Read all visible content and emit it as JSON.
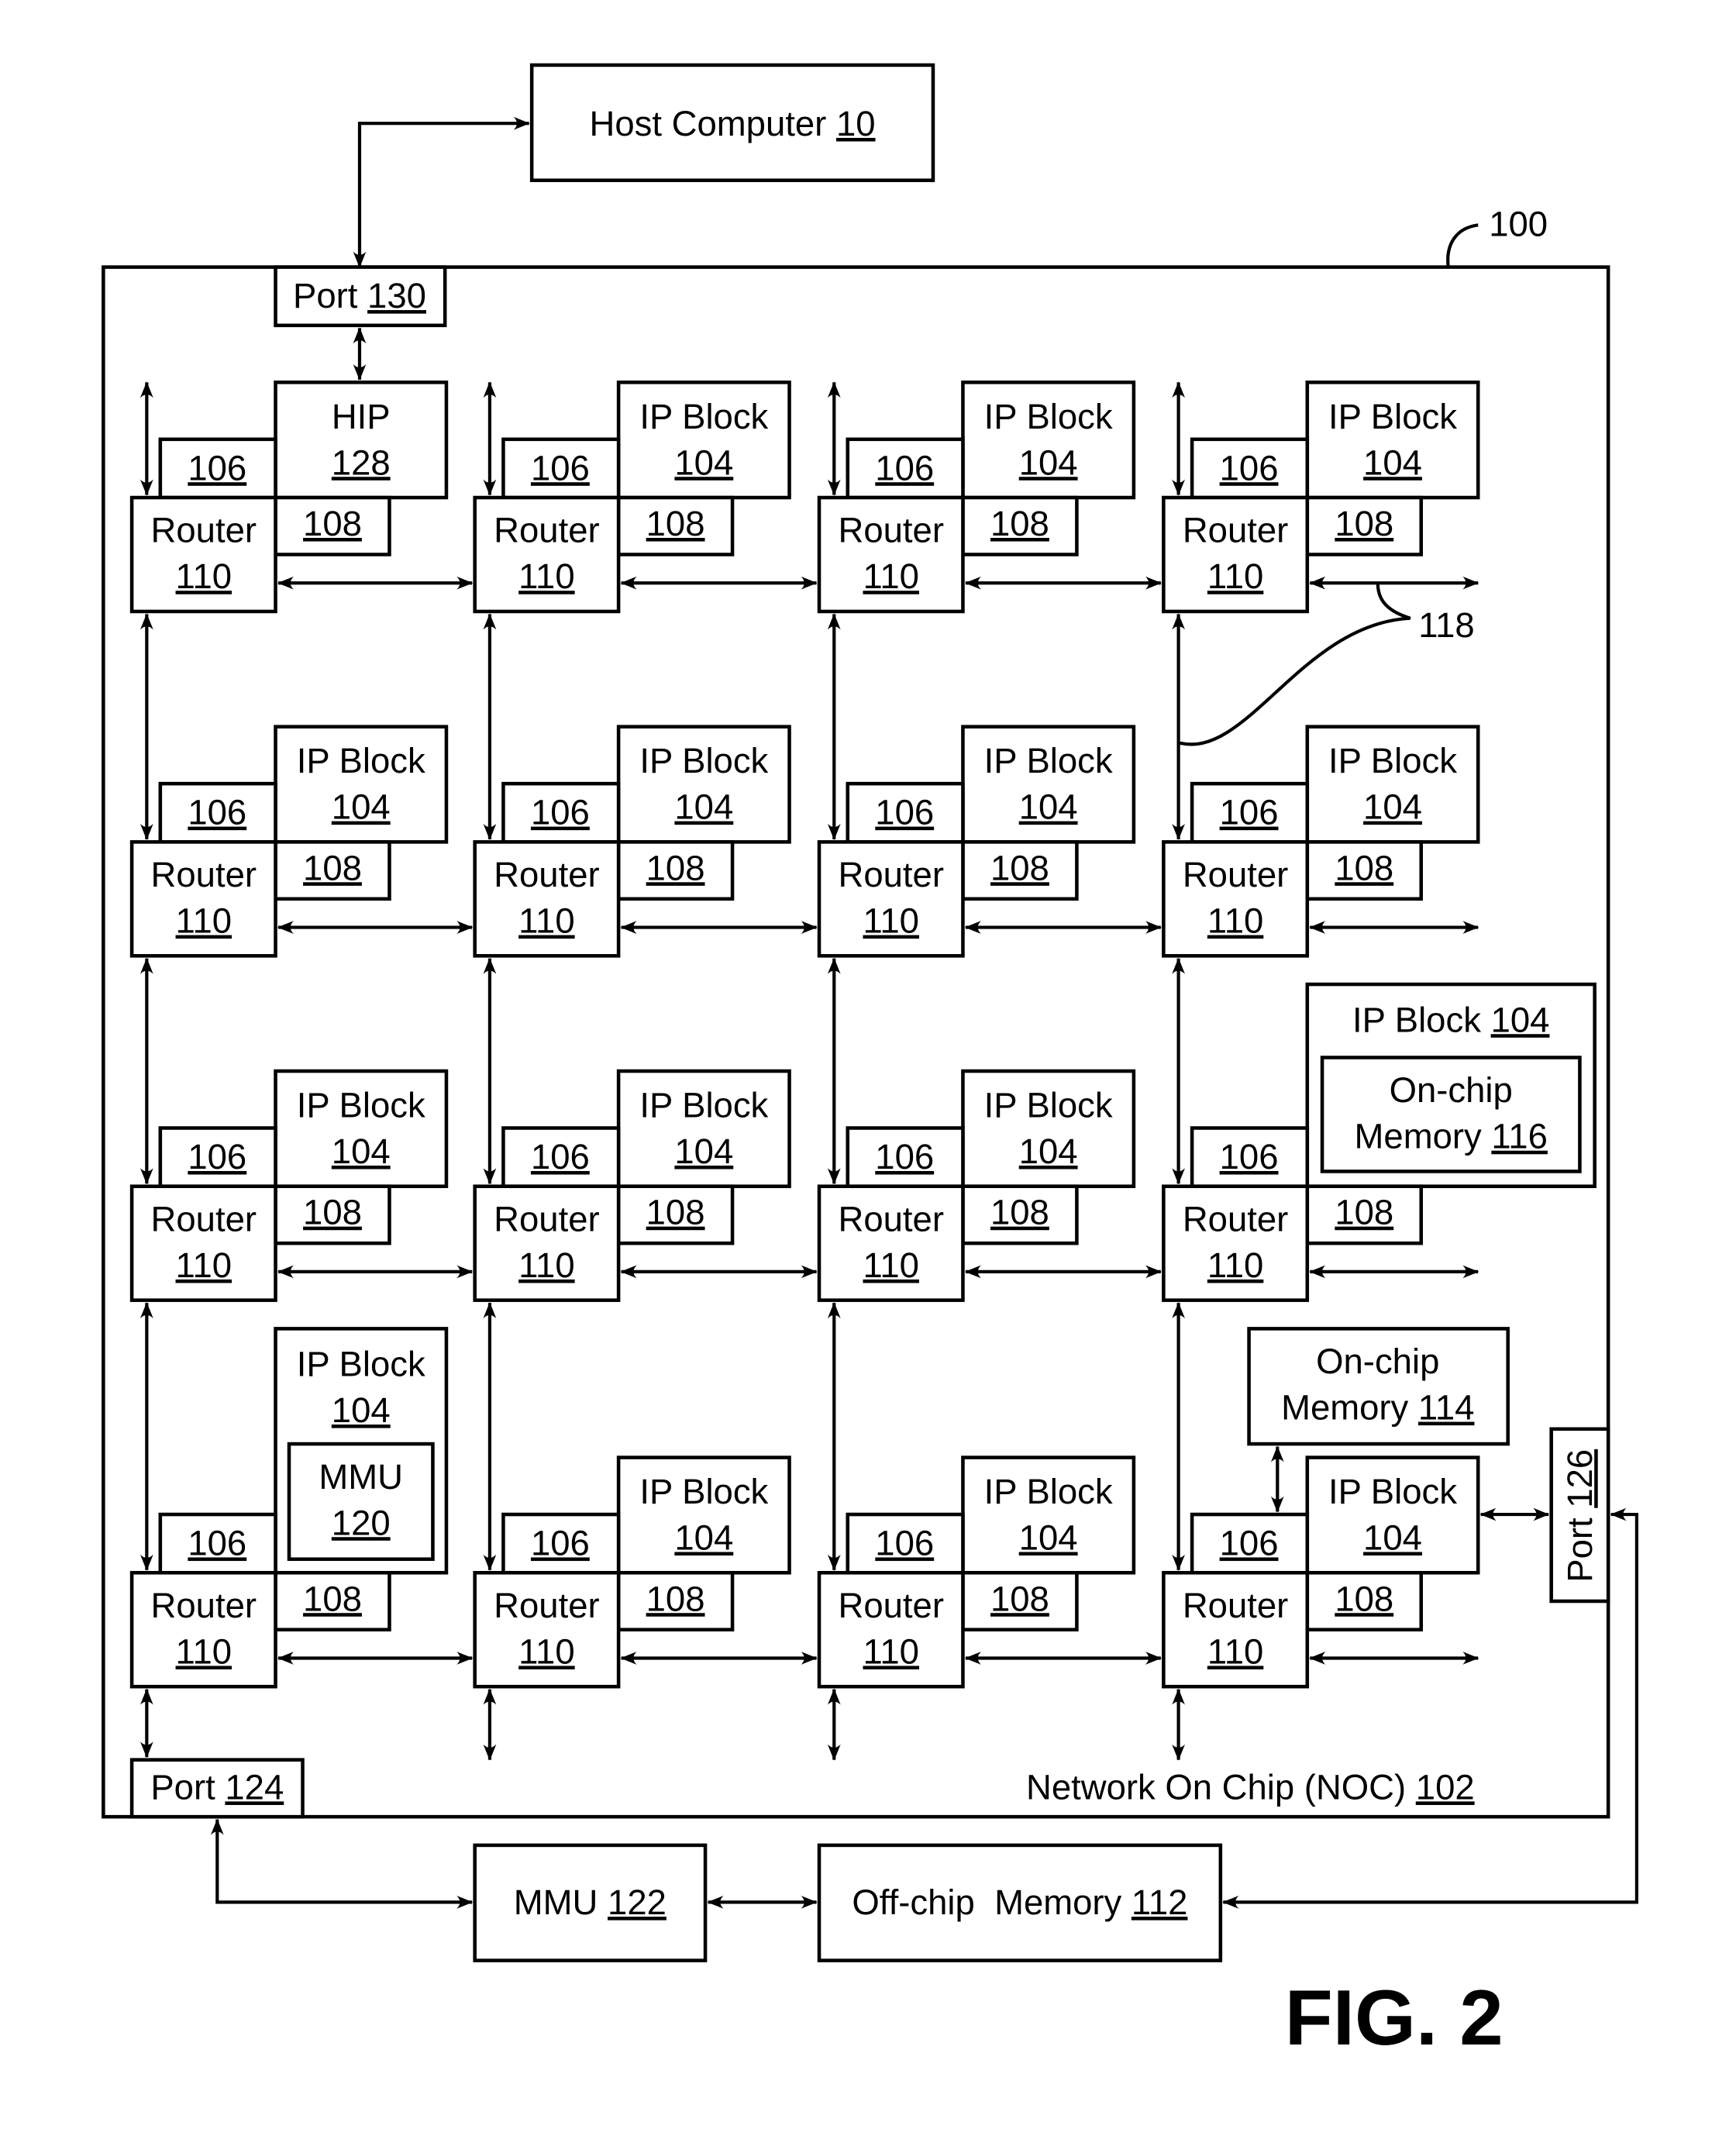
{
  "figure": {
    "title": "FIG. 2",
    "ref_outer": "100",
    "ref_links": "118"
  },
  "host": {
    "label": "Host Computer",
    "ref": "10"
  },
  "noc": {
    "label": "Network On Chip (NOC)",
    "ref": "102"
  },
  "ports": {
    "p130": {
      "label": "Port",
      "ref": "130"
    },
    "p124": {
      "label": "Port",
      "ref": "124"
    },
    "p126": {
      "label": "Port",
      "ref": "126"
    }
  },
  "node_labels": {
    "router": "Router",
    "router_ref": "110",
    "ni_ref": "106",
    "mc_ref": "108",
    "ip_block": "IP Block",
    "ip_ref": "104"
  },
  "special": {
    "hip": {
      "label": "HIP",
      "ref": "128"
    },
    "mmu_on": {
      "label": "MMU",
      "ref": "120"
    },
    "onchip116": {
      "line1": "On-chip",
      "line2": "Memory",
      "ref": "116"
    },
    "onchip114": {
      "line1": "On-chip",
      "line2": "Memory",
      "ref": "114"
    }
  },
  "external": {
    "mmu122": {
      "label": "MMU",
      "ref": "122"
    },
    "offchip": {
      "label": "Off-chip  Memory",
      "ref": "112"
    }
  },
  "grid": {
    "rows": 4,
    "cols": 4,
    "ip_variants": [
      [
        "hip",
        "standard",
        "standard",
        "standard"
      ],
      [
        "standard",
        "standard",
        "standard",
        "standard"
      ],
      [
        "standard",
        "standard",
        "standard",
        "ip_with_onchip116"
      ],
      [
        "ip_with_mmu120",
        "standard",
        "standard",
        "ip_with_onchip114"
      ]
    ]
  }
}
